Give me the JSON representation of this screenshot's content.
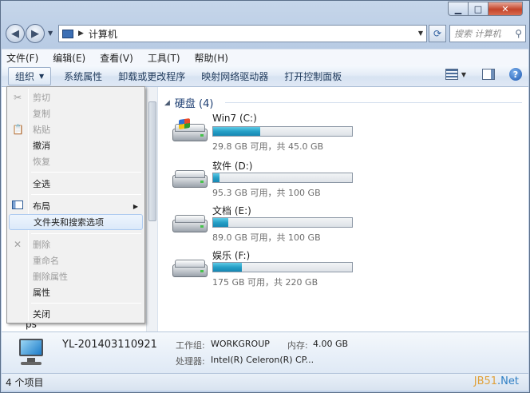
{
  "window": {
    "controls": {
      "minimize": "▁",
      "maximize": "□",
      "close": "✕"
    }
  },
  "address": {
    "path": "计算机",
    "search_placeholder": "搜索 计算机"
  },
  "menubar": {
    "items": [
      "文件(F)",
      "编辑(E)",
      "查看(V)",
      "工具(T)",
      "帮助(H)"
    ]
  },
  "toolbar": {
    "organize": "组织",
    "items": [
      "系统属性",
      "卸载或更改程序",
      "映射网络驱动器",
      "打开控制面板"
    ]
  },
  "drives": {
    "header": "硬盘 (4)",
    "items": [
      {
        "name": "Win7 (C:)",
        "info": "29.8 GB 可用，共 45.0 GB",
        "used_fraction": 0.338,
        "system": true
      },
      {
        "name": "软件 (D:)",
        "info": "95.3 GB 可用，共 100 GB",
        "used_fraction": 0.047,
        "system": false
      },
      {
        "name": "文档 (E:)",
        "info": "89.0 GB 可用，共 100 GB",
        "used_fraction": 0.11,
        "system": false
      },
      {
        "name": "娱乐 (F:)",
        "info": "175 GB 可用，共 220 GB",
        "used_fraction": 0.205,
        "system": false
      }
    ]
  },
  "context_menu": {
    "cut": "剪切",
    "copy": "复制",
    "paste": "粘贴",
    "undo": "撤消",
    "redo": "恢复",
    "select_all": "全选",
    "layout": "布局",
    "folder_options": "文件夹和搜索选项",
    "delete": "删除",
    "rename": "重命名",
    "remove_properties": "删除属性",
    "properties": "属性",
    "close": "关闭"
  },
  "nav": {
    "partial_item": "ps"
  },
  "details": {
    "computer_name": "YL-201403110921",
    "workgroup_label": "工作组:",
    "workgroup_value": "WORKGROUP",
    "memory_label": "内存:",
    "memory_value": "4.00 GB",
    "processor_label": "处理器:",
    "processor_value": "Intel(R) Celeron(R) CP..."
  },
  "status": {
    "count": "4 个项目",
    "watermark_a": "JB51",
    "watermark_b": ".Net"
  }
}
